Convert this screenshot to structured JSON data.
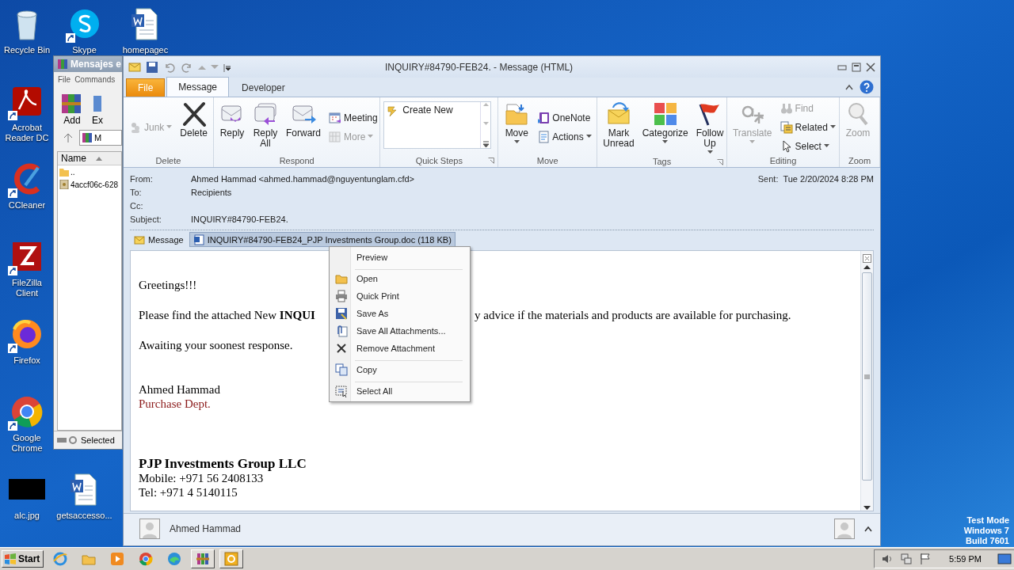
{
  "desktop_icons": [
    {
      "label": "Recycle Bin",
      "shortcut": false
    },
    {
      "label": "Acrobat Reader DC",
      "shortcut": true
    },
    {
      "label": "CCleaner",
      "shortcut": true
    },
    {
      "label": "FileZilla Client",
      "shortcut": true
    },
    {
      "label": "Firefox",
      "shortcut": true
    },
    {
      "label": "Google Chrome",
      "shortcut": true
    },
    {
      "label": "alc.jpg",
      "shortcut": false
    },
    {
      "label": "Skype",
      "shortcut": true
    },
    {
      "label": "getsaccesso...",
      "shortcut": false
    },
    {
      "label": "homepagec",
      "shortcut": false
    }
  ],
  "archive_window": {
    "title": "Mensajes e",
    "menu": [
      "File",
      "Commands"
    ],
    "toolbar": [
      "Add",
      "Ex"
    ],
    "path": "M",
    "column": "Name",
    "rows": [
      {
        "name": "..",
        "kind": "folder"
      },
      {
        "name": "4accf06c-628",
        "kind": "file"
      }
    ],
    "status": "Selected"
  },
  "mail_window": {
    "title": "INQUIRY#84790-FEB24. - Message (HTML)",
    "tabs": [
      {
        "label": "File",
        "kind": "menu",
        "selected": false
      },
      {
        "label": "Message",
        "kind": "tab",
        "selected": true
      },
      {
        "label": "Developer",
        "kind": "tab",
        "selected": false
      }
    ],
    "ribbon": {
      "groups": [
        {
          "label": "Delete",
          "launcher": false,
          "items": [
            {
              "kind": "small",
              "label": "Junk",
              "disabled": true,
              "dropdown": true
            },
            {
              "kind": "large",
              "label": "Delete",
              "disabled": false,
              "dropdown": false
            }
          ]
        },
        {
          "label": "Respond",
          "launcher": false,
          "items": [
            {
              "kind": "large",
              "label": "Reply",
              "disabled": false,
              "dropdown": false
            },
            {
              "kind": "large",
              "label": "Reply All",
              "disabled": false,
              "dropdown": false
            },
            {
              "kind": "large",
              "label": "Forward",
              "disabled": false,
              "dropdown": false
            },
            {
              "kind": "small",
              "label": "Meeting",
              "disabled": false,
              "dropdown": false
            },
            {
              "kind": "small",
              "label": "More",
              "disabled": true,
              "dropdown": true
            }
          ]
        },
        {
          "label": "Quick Steps",
          "launcher": true,
          "items": [
            {
              "kind": "gallery",
              "label": "Create New",
              "disabled": false
            }
          ]
        },
        {
          "label": "Move",
          "launcher": false,
          "items": [
            {
              "kind": "large",
              "label": "Move",
              "disabled": false,
              "dropdown": true
            },
            {
              "kind": "small",
              "label": "OneNote",
              "disabled": false,
              "dropdown": false
            },
            {
              "kind": "small",
              "label": "Actions",
              "disabled": false,
              "dropdown": true
            }
          ]
        },
        {
          "label": "Tags",
          "launcher": true,
          "items": [
            {
              "kind": "large",
              "label": "Mark Unread",
              "disabled": false,
              "dropdown": false
            },
            {
              "kind": "large",
              "label": "Categorize",
              "disabled": false,
              "dropdown": true
            },
            {
              "kind": "large",
              "label": "Follow Up",
              "disabled": false,
              "dropdown": true
            }
          ]
        },
        {
          "label": "Editing",
          "launcher": false,
          "items": [
            {
              "kind": "large",
              "label": "Translate",
              "disabled": true,
              "dropdown": true
            },
            {
              "kind": "small",
              "label": "Find",
              "disabled": true,
              "dropdown": false
            },
            {
              "kind": "small",
              "label": "Related",
              "disabled": false,
              "dropdown": true
            },
            {
              "kind": "small",
              "label": "Select",
              "disabled": false,
              "dropdown": true
            }
          ]
        },
        {
          "label": "Zoom",
          "launcher": false,
          "items": [
            {
              "kind": "large",
              "label": "Zoom",
              "disabled": true,
              "dropdown": false
            }
          ]
        }
      ]
    },
    "headers": [
      {
        "label": "From:",
        "value": "Ahmed Hammad <ahmed.hammad@nguyentunglam.cfd>"
      },
      {
        "label": "To:",
        "value": "Recipients"
      },
      {
        "label": "Cc:"
      },
      {
        "label": "Subject:",
        "value": "INQUIRY#84790-FEB24."
      }
    ],
    "sent": {
      "label": "Sent:",
      "value": "Tue 2/20/2024 8:28 PM"
    },
    "attachments": [
      {
        "label": "Message",
        "kind": "message",
        "selected": false
      },
      {
        "label": "INQUIRY#84790-FEB24_PJP Investments Group.doc (118 KB)",
        "kind": "document",
        "selected": true
      }
    ],
    "body": [
      {
        "kind": "para",
        "text": "Greetings!!!"
      },
      {
        "kind": "split",
        "left": "Please find the attached New **INQUI**",
        "right": "y advice if the materials and products are available for purchasing."
      },
      {
        "kind": "closing",
        "text": "Awaiting your soonest response."
      },
      {
        "kind": "line",
        "text": "Ahmed Hammad"
      },
      {
        "kind": "accent",
        "text": "Purchase Dept."
      },
      {
        "kind": "heading",
        "text": "PJP Investments Group LLC"
      },
      {
        "kind": "line",
        "text": "Mobile: +971 56 2408133"
      },
      {
        "kind": "line",
        "text": "Tel: +971 4 5140115"
      }
    ],
    "people_pane": {
      "name": "Ahmed Hammad"
    }
  },
  "context_menu": [
    {
      "label": "Preview",
      "separator_after": true
    },
    {
      "label": "Open",
      "separator_after": false
    },
    {
      "label": "Quick Print",
      "separator_after": false
    },
    {
      "label": "Save As",
      "separator_after": false
    },
    {
      "label": "Save All Attachments...",
      "separator_after": false
    },
    {
      "label": "Remove Attachment",
      "separator_after": true
    },
    {
      "label": "Copy",
      "separator_after": true
    },
    {
      "label": "Select All",
      "separator_after": false
    }
  ],
  "taskbar": {
    "start": "Start",
    "apps": [
      {
        "open": false
      },
      {
        "open": false
      },
      {
        "open": false
      },
      {
        "open": false
      },
      {
        "open": false
      },
      {
        "open": true
      },
      {
        "open": true
      }
    ],
    "clock": "5:59 PM"
  },
  "os_notice": [
    "Test Mode",
    "Windows 7",
    "Build 7601"
  ]
}
